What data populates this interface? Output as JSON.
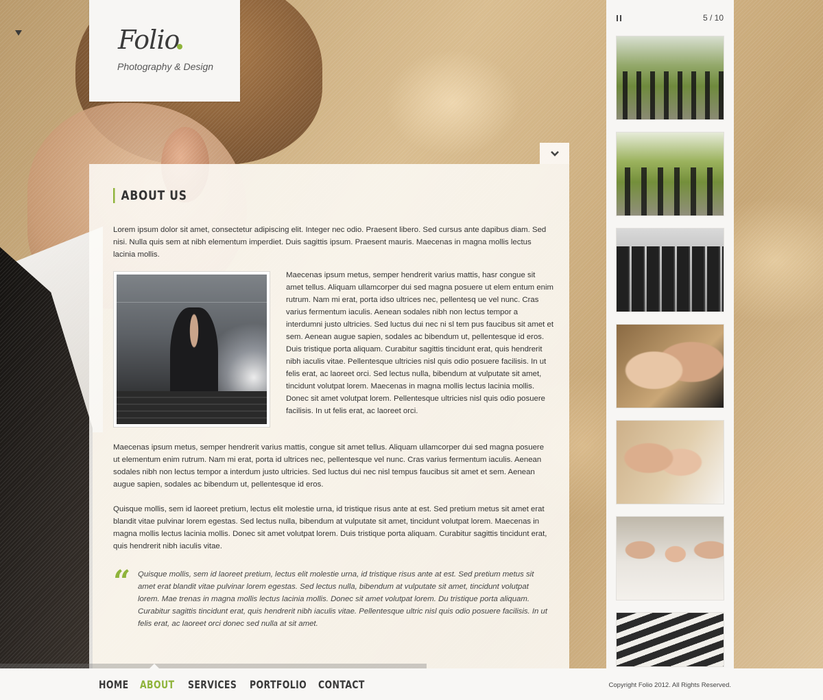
{
  "brand": {
    "name": "Folio",
    "tagline": "Photography & Design",
    "accent_color": "#8fb43b"
  },
  "slideshow": {
    "pause_icon": "pause-icon",
    "counter": "5 / 10",
    "thumbnails": [
      {
        "subject": "wedding-party-under-trees"
      },
      {
        "subject": "bridesmaids-with-bride"
      },
      {
        "subject": "groomsmen-in-suits"
      },
      {
        "subject": "couple-closeup"
      },
      {
        "subject": "couple-touching-foreheads"
      },
      {
        "subject": "bride-with-friends"
      },
      {
        "subject": "place-cards"
      }
    ]
  },
  "content": {
    "collapse_icon": "chevron-down-icon",
    "title": "ABOUT US",
    "intro": "Lorem ipsum dolor sit amet, consectetur adipiscing elit. Integer nec odio. Praesent libero. Sed cursus ante dapibus diam. Sed nisi. Nulla quis sem at nibh elementum imperdiet. Duis sagittis ipsum. Praesent mauris. Maecenas in magna mollis lectus lacinia mollis.",
    "side_text": "Maecenas ipsum metus, semper hendrerit varius mattis, hasr congue sit amet tellus. Aliquam ullamcorper dui sed magna posuere ut elem entum enim rutrum. Nam mi erat, porta idso ultrices nec, pellentesq ue vel nunc. Cras varius fermentum iaculis. Aenean sodales nibh non lectus tempor a interdumni justo ultricies. Sed luctus dui nec ni sl tem pus faucibus sit amet et sem. Aenean augue sapien, sodales ac bibendum ut, pellentesque id eros. Duis tristique porta aliquam. Curabitur sagittis tincidunt erat, quis hendrerit nibh iaculis vitae. Pellentesque ultricies nisl quis odio posuere facilisis. In ut felis erat, ac laoreet orci. Sed lectus nulla, bibendum at vulputate sit amet, tincidunt volutpat lorem. Maecenas in magna mollis lectus lacinia mollis. Donec sit amet volutpat lorem. Pellentesque ultricies nisl quis odio posuere facilisis. In ut felis erat, ac laoreet orci.",
    "paragraph_2": "Maecenas ipsum metus, semper hendrerit varius mattis, congue sit amet tellus. Aliquam ullamcorper dui sed magna posuere ut elementum enim rutrum. Nam mi erat, porta id ultrices nec, pellentesque vel nunc. Cras varius fermentum iaculis. Aenean sodales nibh non lectus tempor a interdum justo ultricies. Sed luctus dui nec nisl tempus faucibus sit amet et sem. Aenean augue sapien, sodales ac bibendum ut, pellentesque id eros.",
    "paragraph_3": "Quisque mollis, sem id laoreet pretium, lectus elit molestie urna, id tristique risus ante at est. Sed pretium metus sit amet erat blandit vitae pulvinar lorem egestas. Sed lectus nulla, bibendum at vulputate sit amet, tincidunt volutpat lorem. Maecenas in magna mollis lectus lacinia mollis. Donec sit amet volutpat lorem. Duis tristique porta aliquam. Curabitur sagittis tincidunt erat, quis hendrerit nibh iaculis vitae.",
    "quote_mark": "“",
    "quote": "Quisque mollis, sem id laoreet pretium, lectus elit molestie urna, id tristique risus ante at est. Sed pretium metus sit amet erat blandit vitae pulvinar lorem egestas. Sed lectus nulla, bibendum at vulputate sit amet, tincidunt volutpat lorem. Mae trenas in magna mollis lectus lacinia mollis. Donec sit amet volutpat lorem. Du tristique porta aliquam. Curabitur sagittis tincidunt erat, quis hendrerit nibh iaculis vitae. Pellentesque ultric nisl quis odio posuere facilisis. In ut felis erat, ac laoreet orci donec sed nulla at sit amet."
  },
  "nav": {
    "items": [
      "HOME",
      "ABOUT",
      "SERVICES",
      "PORTFOLIO",
      "CONTACT"
    ],
    "active": "ABOUT"
  },
  "footer": {
    "copyright": "Copyright Folio 2012. All Rights Reserved."
  }
}
